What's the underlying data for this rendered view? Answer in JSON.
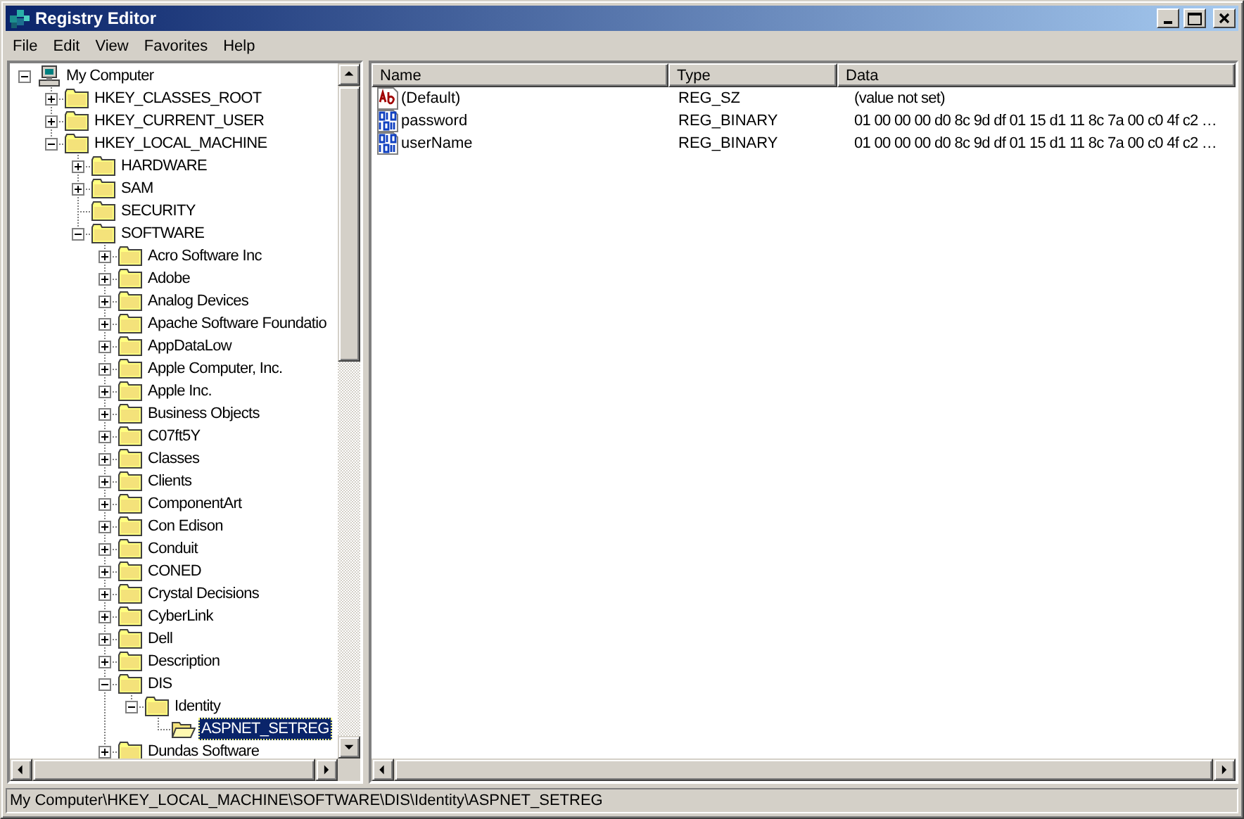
{
  "window": {
    "title": "Registry Editor"
  },
  "menu": [
    {
      "label": "File"
    },
    {
      "label": "Edit"
    },
    {
      "label": "View"
    },
    {
      "label": "Favorites"
    },
    {
      "label": "Help"
    }
  ],
  "tree": [
    {
      "label": "My Computer",
      "kind": "computer",
      "expanded": true,
      "selected": false,
      "children": [
        {
          "label": "HKEY_CLASSES_ROOT",
          "kind": "folder",
          "expanded": false,
          "selected": false
        },
        {
          "label": "HKEY_CURRENT_USER",
          "kind": "folder",
          "expanded": false,
          "selected": false
        },
        {
          "label": "HKEY_LOCAL_MACHINE",
          "kind": "folder",
          "expanded": true,
          "selected": false,
          "children": [
            {
              "label": "HARDWARE",
              "kind": "folder",
              "expanded": false,
              "selected": false
            },
            {
              "label": "SAM",
              "kind": "folder",
              "expanded": false,
              "selected": false
            },
            {
              "label": "SECURITY",
              "kind": "folder",
              "selected": false
            },
            {
              "label": "SOFTWARE",
              "kind": "folder",
              "expanded": true,
              "selected": false,
              "children": [
                {
                  "label": "Acro Software Inc",
                  "kind": "folder",
                  "expanded": false,
                  "selected": false
                },
                {
                  "label": "Adobe",
                  "kind": "folder",
                  "expanded": false,
                  "selected": false
                },
                {
                  "label": "Analog Devices",
                  "kind": "folder",
                  "expanded": false,
                  "selected": false
                },
                {
                  "label": "Apache Software Foundatio",
                  "kind": "folder",
                  "expanded": false,
                  "selected": false
                },
                {
                  "label": "AppDataLow",
                  "kind": "folder",
                  "expanded": false,
                  "selected": false
                },
                {
                  "label": "Apple Computer, Inc.",
                  "kind": "folder",
                  "expanded": false,
                  "selected": false
                },
                {
                  "label": "Apple Inc.",
                  "kind": "folder",
                  "expanded": false,
                  "selected": false
                },
                {
                  "label": "Business Objects",
                  "kind": "folder",
                  "expanded": false,
                  "selected": false
                },
                {
                  "label": "C07ft5Y",
                  "kind": "folder",
                  "expanded": false,
                  "selected": false
                },
                {
                  "label": "Classes",
                  "kind": "folder",
                  "expanded": false,
                  "selected": false
                },
                {
                  "label": "Clients",
                  "kind": "folder",
                  "expanded": false,
                  "selected": false
                },
                {
                  "label": "ComponentArt",
                  "kind": "folder",
                  "expanded": false,
                  "selected": false
                },
                {
                  "label": "Con Edison",
                  "kind": "folder",
                  "expanded": false,
                  "selected": false
                },
                {
                  "label": "Conduit",
                  "kind": "folder",
                  "expanded": false,
                  "selected": false
                },
                {
                  "label": "CONED",
                  "kind": "folder",
                  "expanded": false,
                  "selected": false
                },
                {
                  "label": "Crystal Decisions",
                  "kind": "folder",
                  "expanded": false,
                  "selected": false
                },
                {
                  "label": "CyberLink",
                  "kind": "folder",
                  "expanded": false,
                  "selected": false
                },
                {
                  "label": "Dell",
                  "kind": "folder",
                  "expanded": false,
                  "selected": false
                },
                {
                  "label": "Description",
                  "kind": "folder",
                  "expanded": false,
                  "selected": false
                },
                {
                  "label": "DIS",
                  "kind": "folder",
                  "expanded": true,
                  "selected": false,
                  "children": [
                    {
                      "label": "Identity",
                      "kind": "folder",
                      "expanded": true,
                      "selected": false,
                      "children": [
                        {
                          "label": "ASPNET_SETREG",
                          "kind": "folder",
                          "selected": true
                        }
                      ]
                    }
                  ]
                },
                {
                  "label": "Dundas Software",
                  "kind": "folder",
                  "expanded": false,
                  "selected": false
                }
              ]
            }
          ]
        }
      ]
    }
  ],
  "list": {
    "columns": [
      "Name",
      "Type",
      "Data"
    ],
    "rows": [
      {
        "kind": "string",
        "name": "(Default)",
        "type": "REG_SZ",
        "data": "(value not set)"
      },
      {
        "kind": "binary",
        "name": "password",
        "type": "REG_BINARY",
        "data": "01 00 00 00 d0 8c 9d df 01 15 d1 11 8c 7a 00 c0 4f c2 …"
      },
      {
        "kind": "binary",
        "name": "userName",
        "type": "REG_BINARY",
        "data": "01 00 00 00 d0 8c 9d df 01 15 d1 11 8c 7a 00 c0 4f c2 …"
      }
    ]
  },
  "status_bar": "My Computer\\HKEY_LOCAL_MACHINE\\SOFTWARE\\DIS\\Identity\\ASPNET_SETREG"
}
